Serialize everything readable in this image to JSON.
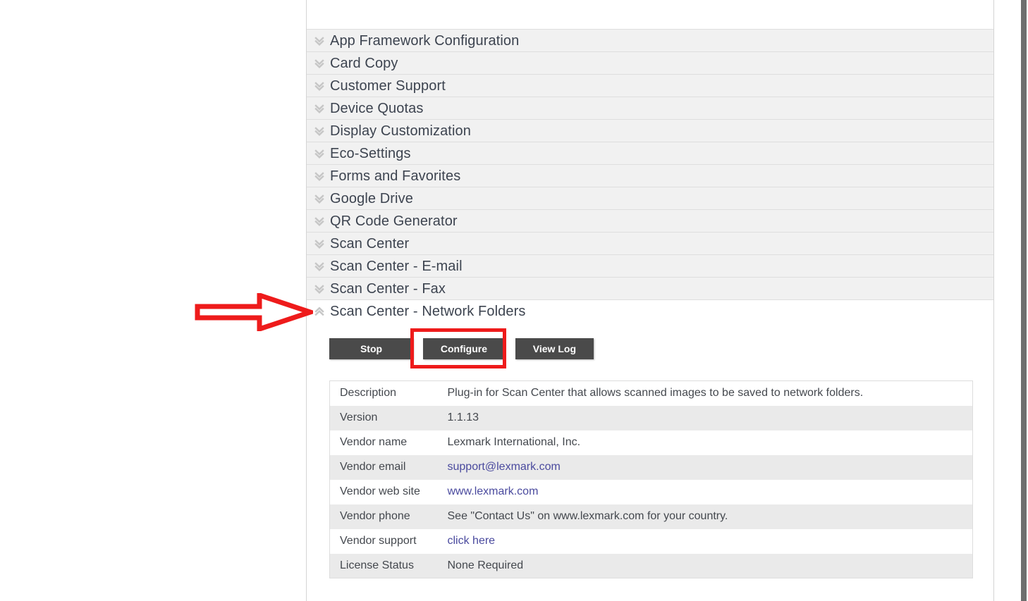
{
  "panel": {
    "app_rows": [
      {
        "label": "App Framework Configuration",
        "expanded": false,
        "icon": "chevron-double-down-icon"
      },
      {
        "label": "Card Copy",
        "expanded": false,
        "icon": "chevron-double-down-icon"
      },
      {
        "label": "Customer Support",
        "expanded": false,
        "icon": "chevron-double-down-icon"
      },
      {
        "label": "Device Quotas",
        "expanded": false,
        "icon": "chevron-double-down-icon"
      },
      {
        "label": "Display Customization",
        "expanded": false,
        "icon": "chevron-double-down-icon"
      },
      {
        "label": "Eco-Settings",
        "expanded": false,
        "icon": "chevron-double-down-icon"
      },
      {
        "label": "Forms and Favorites",
        "expanded": false,
        "icon": "chevron-double-down-icon"
      },
      {
        "label": "Google Drive",
        "expanded": false,
        "icon": "chevron-double-down-icon"
      },
      {
        "label": "QR Code Generator",
        "expanded": false,
        "icon": "chevron-double-down-icon"
      },
      {
        "label": "Scan Center",
        "expanded": false,
        "icon": "chevron-double-down-icon"
      },
      {
        "label": "Scan Center - E-mail",
        "expanded": false,
        "icon": "chevron-double-down-icon"
      },
      {
        "label": "Scan Center - Fax",
        "expanded": false,
        "icon": "chevron-double-down-icon"
      },
      {
        "label": "Scan Center - Network Folders",
        "expanded": true,
        "icon": "chevron-double-up-icon"
      }
    ]
  },
  "detail": {
    "buttons": {
      "stop": "Stop",
      "configure": "Configure",
      "view_log": "View Log"
    },
    "info_rows": [
      {
        "label": "Description",
        "value": "Plug-in for Scan Center that allows scanned images to be saved to network folders.",
        "link": false
      },
      {
        "label": "Version",
        "value": "1.1.13",
        "link": false
      },
      {
        "label": "Vendor name",
        "value": "Lexmark International, Inc.",
        "link": false
      },
      {
        "label": "Vendor email",
        "value": "support@lexmark.com",
        "link": true
      },
      {
        "label": "Vendor web site",
        "value": "www.lexmark.com",
        "link": true
      },
      {
        "label": "Vendor phone",
        "value": "See \"Contact Us\" on www.lexmark.com for your country.",
        "link": false
      },
      {
        "label": "Vendor support",
        "value": "click here",
        "link": true
      },
      {
        "label": "License Status",
        "value": "None Required",
        "link": false
      }
    ]
  },
  "annotations": {
    "arrow": {
      "name": "red-arrow-annotation",
      "color": "#ee1b1b",
      "points_to": "Scan Center - Network Folders"
    },
    "configure_highlight": {
      "name": "red-box-annotation",
      "color": "#ee1b1b",
      "surrounds": "Configure"
    }
  },
  "colors": {
    "button_bg": "#4a4a4a",
    "row_bg": "#f1f1f1",
    "annotation_red": "#ee1b1b",
    "link": "#4a4a9e",
    "text": "#3d4450"
  },
  "scrollbar": {
    "orientation": "vertical",
    "position": "right"
  }
}
